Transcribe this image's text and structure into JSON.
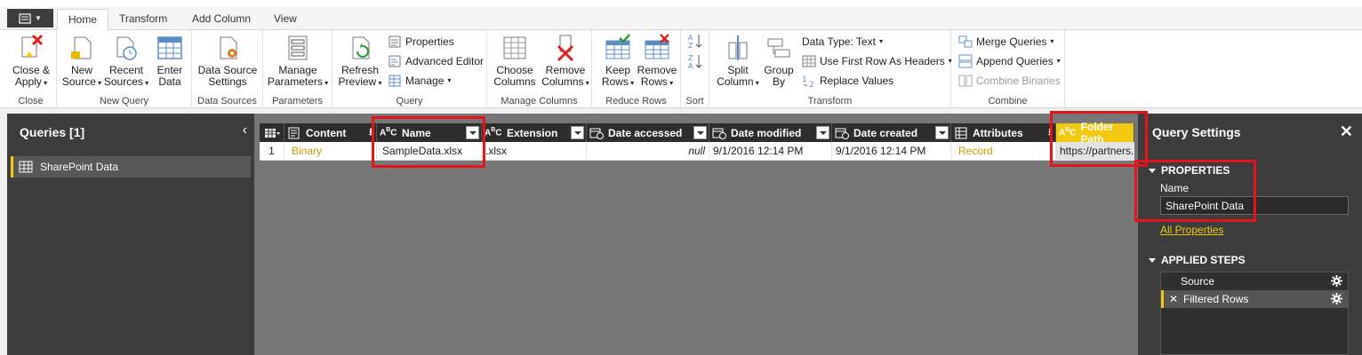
{
  "colors": {
    "accent": "#f2c811",
    "highlight": "#e3141b",
    "panel": "#3c3c3c"
  },
  "tabs": [
    "Home",
    "Transform",
    "Add Column",
    "View"
  ],
  "ribbon": {
    "close": {
      "btn": [
        "Close &",
        "Apply"
      ],
      "label": "Close"
    },
    "new_query": {
      "new_source": [
        "New",
        "Source"
      ],
      "recent_sources": [
        "Recent",
        "Sources"
      ],
      "enter_data": [
        "Enter",
        "Data"
      ],
      "label": "New Query"
    },
    "data_sources": {
      "btn": [
        "Data Source",
        "Settings"
      ],
      "label": "Data Sources"
    },
    "parameters": {
      "btn": [
        "Manage",
        "Parameters"
      ],
      "label": "Parameters"
    },
    "query": {
      "refresh": [
        "Refresh",
        "Preview"
      ],
      "properties": "Properties",
      "advanced_editor": "Advanced Editor",
      "manage": "Manage",
      "label": "Query"
    },
    "manage_columns": {
      "choose": [
        "Choose",
        "Columns"
      ],
      "remove": [
        "Remove",
        "Columns"
      ],
      "label": "Manage Columns"
    },
    "reduce_rows": {
      "keep": [
        "Keep",
        "Rows"
      ],
      "remove": [
        "Remove",
        "Rows"
      ],
      "label": "Reduce Rows"
    },
    "sort": {
      "label": "Sort"
    },
    "transform": {
      "split": [
        "Split",
        "Column"
      ],
      "group": [
        "Group",
        "By"
      ],
      "data_type": "Data Type: Text",
      "first_row": "Use First Row As Headers",
      "replace": "Replace Values",
      "label": "Transform"
    },
    "combine": {
      "merge": "Merge Queries",
      "append": "Append Queries",
      "binaries": "Combine Binaries",
      "label": "Combine"
    }
  },
  "queries_pane": {
    "title": "Queries [1]",
    "items": [
      "SharePoint Data"
    ]
  },
  "grid": {
    "columns": [
      "Content",
      "Name",
      "Extension",
      "Date accessed",
      "Date modified",
      "Date created",
      "Attributes",
      "Folder Path"
    ],
    "row": {
      "num": "1",
      "content": "Binary",
      "name": "SampleData.xlsx",
      "extension": ".xlsx",
      "date_accessed": "null",
      "date_modified": "9/1/2016 12:14 PM",
      "date_created": "9/1/2016 12:14 PM",
      "attributes": "Record",
      "folder_path": "https://partners."
    }
  },
  "settings": {
    "title": "Query Settings",
    "properties": "PROPERTIES",
    "name_label": "Name",
    "name_value": "SharePoint Data",
    "all_properties": "All Properties",
    "applied_steps": "APPLIED STEPS",
    "steps": [
      "Source",
      "Filtered Rows"
    ]
  }
}
